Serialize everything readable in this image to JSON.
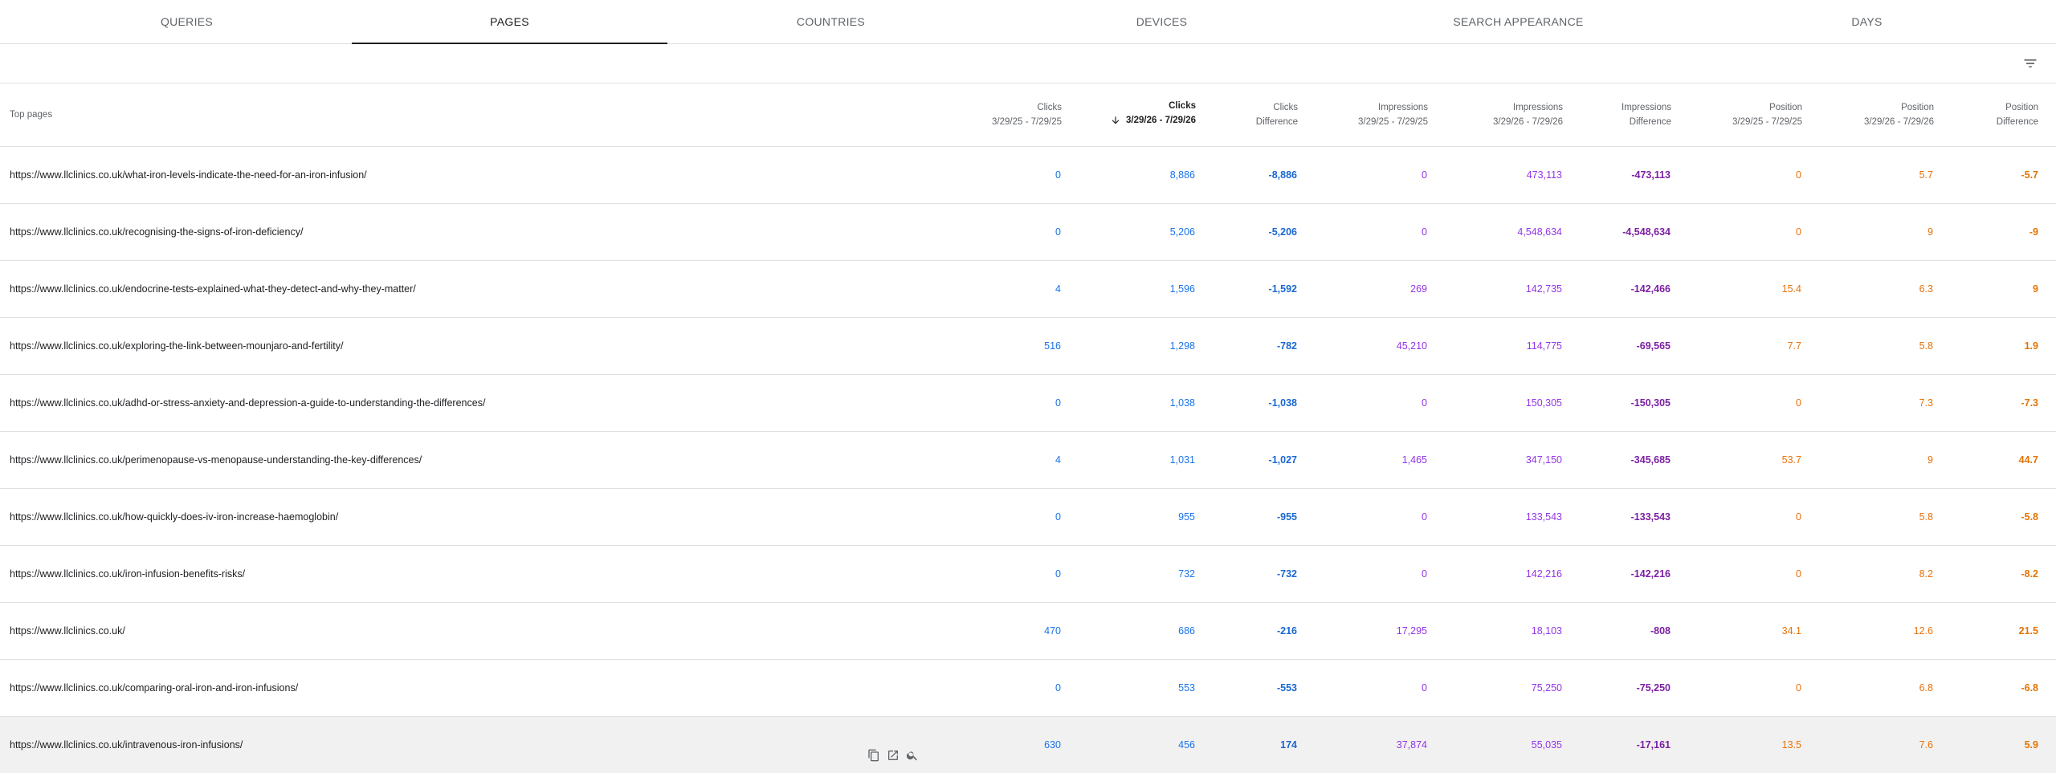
{
  "tabs": [
    {
      "label": "Queries"
    },
    {
      "label": "Pages"
    },
    {
      "label": "Countries"
    },
    {
      "label": "Devices"
    },
    {
      "label": "Search appearance"
    },
    {
      "label": "Days"
    }
  ],
  "active_tab": "Pages",
  "table": {
    "first_header": "Top pages",
    "columns": [
      {
        "l1": "Clicks",
        "l2": "3/29/25 - 7/29/25"
      },
      {
        "l1": "Clicks",
        "l2": "3/29/26 - 7/29/26"
      },
      {
        "l1": "Clicks",
        "l2": "Difference"
      },
      {
        "l1": "Impressions",
        "l2": "3/29/25 - 7/29/25"
      },
      {
        "l1": "Impressions",
        "l2": "3/29/26 - 7/29/26"
      },
      {
        "l1": "Impressions",
        "l2": "Difference"
      },
      {
        "l1": "Position",
        "l2": "3/29/25 - 7/29/25"
      },
      {
        "l1": "Position",
        "l2": "3/29/26 - 7/29/26"
      },
      {
        "l1": "Position",
        "l2": "Difference"
      }
    ],
    "rows": [
      {
        "url": "https://www.llclinics.co.uk/what-iron-levels-indicate-the-need-for-an-iron-infusion/",
        "v": [
          "0",
          "8,886",
          "-8,886",
          "0",
          "473,113",
          "-473,113",
          "0",
          "5.7",
          "-5.7"
        ]
      },
      {
        "url": "https://www.llclinics.co.uk/recognising-the-signs-of-iron-deficiency/",
        "v": [
          "0",
          "5,206",
          "-5,206",
          "0",
          "4,548,634",
          "-4,548,634",
          "0",
          "9",
          "-9"
        ]
      },
      {
        "url": "https://www.llclinics.co.uk/endocrine-tests-explained-what-they-detect-and-why-they-matter/",
        "v": [
          "4",
          "1,596",
          "-1,592",
          "269",
          "142,735",
          "-142,466",
          "15.4",
          "6.3",
          "9"
        ]
      },
      {
        "url": "https://www.llclinics.co.uk/exploring-the-link-between-mounjaro-and-fertility/",
        "v": [
          "516",
          "1,298",
          "-782",
          "45,210",
          "114,775",
          "-69,565",
          "7.7",
          "5.8",
          "1.9"
        ]
      },
      {
        "url": "https://www.llclinics.co.uk/adhd-or-stress-anxiety-and-depression-a-guide-to-understanding-the-differences/",
        "v": [
          "0",
          "1,038",
          "-1,038",
          "0",
          "150,305",
          "-150,305",
          "0",
          "7.3",
          "-7.3"
        ]
      },
      {
        "url": "https://www.llclinics.co.uk/perimenopause-vs-menopause-understanding-the-key-differences/",
        "v": [
          "4",
          "1,031",
          "-1,027",
          "1,465",
          "347,150",
          "-345,685",
          "53.7",
          "9",
          "44.7"
        ]
      },
      {
        "url": "https://www.llclinics.co.uk/how-quickly-does-iv-iron-increase-haemoglobin/",
        "v": [
          "0",
          "955",
          "-955",
          "0",
          "133,543",
          "-133,543",
          "0",
          "5.8",
          "-5.8"
        ]
      },
      {
        "url": "https://www.llclinics.co.uk/iron-infusion-benefits-risks/",
        "v": [
          "0",
          "732",
          "-732",
          "0",
          "142,216",
          "-142,216",
          "0",
          "8.2",
          "-8.2"
        ]
      },
      {
        "url": "https://www.llclinics.co.uk/",
        "v": [
          "470",
          "686",
          "-216",
          "17,295",
          "18,103",
          "-808",
          "34.1",
          "12.6",
          "21.5"
        ]
      },
      {
        "url": "https://www.llclinics.co.uk/comparing-oral-iron-and-iron-infusions/",
        "v": [
          "0",
          "553",
          "-553",
          "0",
          "75,250",
          "-75,250",
          "0",
          "6.8",
          "-6.8"
        ]
      },
      {
        "url": "https://www.llclinics.co.uk/intravenous-iron-infusions/",
        "v": [
          "630",
          "456",
          "174",
          "37,874",
          "55,035",
          "-17,161",
          "13.5",
          "7.6",
          "5.9"
        ]
      }
    ]
  },
  "icons": {
    "filter": "filter-icon",
    "sort": "arrow-down-icon",
    "copy": "copy-icon",
    "open": "open-in-new-icon",
    "inspect": "search-icon"
  },
  "colors": {
    "clicks": "#1a73e8",
    "impressions": "#9334e6",
    "position": "#e8710a"
  }
}
